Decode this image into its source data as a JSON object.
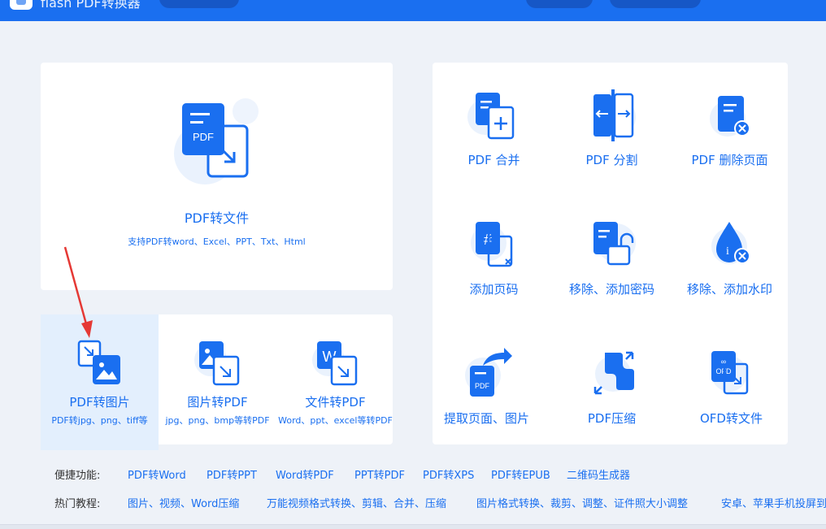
{
  "app": {
    "title": "flash PDF转换器"
  },
  "main_card": {
    "title": "PDF转文件",
    "subtitle": "支持PDF转word、Excel、PPT、Txt、Html",
    "icon_label": "PDF"
  },
  "convert_items": [
    {
      "title": "PDF转图片",
      "subtitle": "PDF转jpg、png、tiff等"
    },
    {
      "title": "图片转PDF",
      "subtitle": "jpg、png、bmp等转PDF"
    },
    {
      "title": "文件转PDF",
      "subtitle": "Word、ppt、excel等转PDF",
      "icon_label": "W"
    }
  ],
  "tools": [
    {
      "title": "PDF 合并"
    },
    {
      "title": "PDF 分割"
    },
    {
      "title": "PDF 删除页面"
    },
    {
      "title": "添加页码",
      "icon_label": "#"
    },
    {
      "title": "移除、添加密码"
    },
    {
      "title": "移除、添加水印",
      "icon_label": "i"
    },
    {
      "title": "提取页面、图片",
      "icon_label": "PDF"
    },
    {
      "title": "PDF压缩"
    },
    {
      "title": "OFD转文件",
      "icon_label": "OFD"
    }
  ],
  "quick": {
    "label": "便捷功能:",
    "links": [
      "PDF转Word",
      "PDF转PPT",
      "Word转PDF",
      "PPT转PDF",
      "PDF转XPS",
      "PDF转EPUB",
      "二维码生成器"
    ]
  },
  "tutorials": {
    "label": "热门教程:",
    "links": [
      "图片、视频、Word压缩",
      "万能视频格式转换、剪辑、合并、压缩",
      "图片格式转换、裁剪、调整、证件照大小调整",
      "安卓、苹果手机投屏到"
    ]
  },
  "colors": {
    "accent": "#1a6ff0",
    "bg": "#eef2f8",
    "active_bg": "#e3effd",
    "annotation_arrow": "#e53935"
  }
}
